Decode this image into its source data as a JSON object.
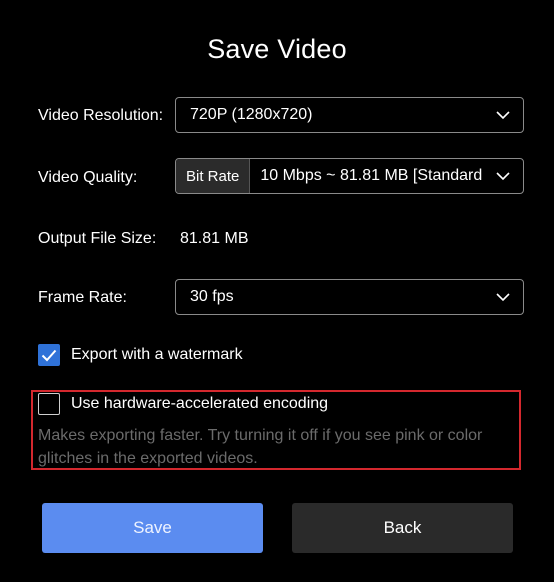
{
  "dialog": {
    "title": "Save Video"
  },
  "resolution": {
    "label": "Video Resolution:",
    "value": "720P (1280x720)"
  },
  "quality": {
    "label": "Video Quality:",
    "prefix": "Bit Rate",
    "value": "10 Mbps ~ 81.81 MB [Standard"
  },
  "file_size": {
    "label": "Output File Size:",
    "value": "81.81 MB"
  },
  "frame_rate": {
    "label": "Frame Rate:",
    "value": "30 fps"
  },
  "watermark": {
    "label": "Export with a watermark",
    "checked": true
  },
  "hardware": {
    "label": "Use hardware-accelerated encoding",
    "checked": false,
    "hint": "Makes exporting faster. Try turning it off if you see pink or color glitches in the exported videos."
  },
  "buttons": {
    "save_label": "Save",
    "back_label": "Back"
  },
  "colors": {
    "background": "#000000",
    "accent": "#2f72d8",
    "save_button": "#5b8cf0",
    "back_button": "#2a2a2a",
    "highlight_border": "#d4282e",
    "hint_text": "#6b6b6b"
  },
  "icons": {
    "dropdown": "chevron-down-icon",
    "check": "checkmark-icon"
  }
}
